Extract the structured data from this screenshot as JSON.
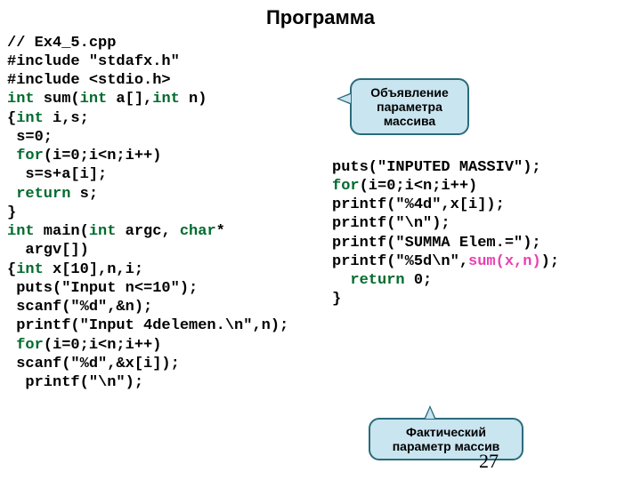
{
  "title": "Программа",
  "left": {
    "l1": "// Ex4_5.cpp",
    "l2": "#include \"stdafx.h\"",
    "l3": "#include <stdio.h>",
    "l4a": "int",
    "l4b": " sum(",
    "l4c": "int",
    "l4d": " a[],",
    "l4e": "int",
    "l4f": " n)",
    "l5a": "{",
    "l5b": "int",
    "l5c": " i,s;",
    "l6": " s=0;",
    "l7a": " ",
    "l7b": "for",
    "l7c": "(i=0;i<n;i++)",
    "l8": "  s=s+a[i];",
    "l9a": " ",
    "l9b": "return",
    "l9c": " s;",
    "l10": "}",
    "l11a": "int",
    "l11b": " main(",
    "l11c": "int",
    "l11d": " argc, ",
    "l11e": "char",
    "l11f": "*",
    "l11g": "  argv[])",
    "l12a": "{",
    "l12b": "int",
    "l12c": " x[10],n,i;",
    "l13": " puts(\"Input n<=10\");",
    "l14": " scanf(\"%d\",&n);",
    "l15": " printf(\"Input 4delemen.\\n\",n);",
    "l16a": " ",
    "l16b": "for",
    "l16c": "(i=0;i<n;i++)",
    "l17": " scanf(\"%d\",&x[i]);",
    "l18": "  printf(\"\\n\");"
  },
  "right": {
    "r1": "puts(\"INPUTED MASSIV\");",
    "r2a": "for",
    "r2b": "(i=0;i<n;i++)",
    "r3": "printf(\"%4d\",x[i]);",
    "r4": "printf(\"\\n\");",
    "r5": "printf(\"SUMMA Elem.=\");",
    "r6a": "printf(\"%5d\\n\",",
    "r6b": "sum(x,n)",
    "r6c": ");",
    "r7a": "  ",
    "r7b": "return",
    "r7c": " 0;",
    "r8": "}"
  },
  "callout1": "Объявление параметра массива",
  "callout2": "Фактический параметр массив",
  "page": "27"
}
